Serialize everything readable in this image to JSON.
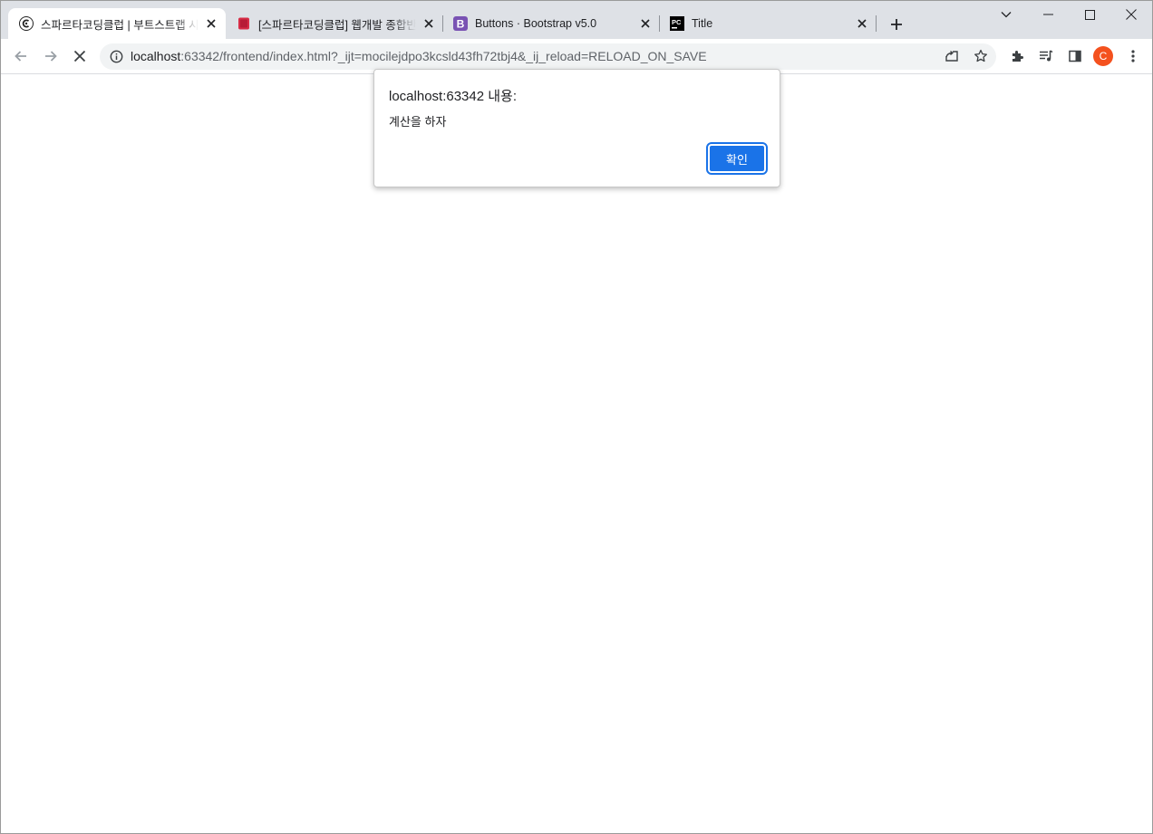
{
  "tabs": [
    {
      "title": "스파르타코딩클럽 | 부트스트랩 시작 템플릿",
      "favicon": "sparta-icon",
      "active": true
    },
    {
      "title": "[스파르타코딩클럽] 웹개발 종합반",
      "favicon": "book-icon",
      "active": false
    },
    {
      "title": "Buttons · Bootstrap v5.0",
      "favicon": "bootstrap-icon",
      "favicon_text": "B",
      "active": false
    },
    {
      "title": "Title",
      "favicon": "pycharm-icon",
      "favicon_text": "PC",
      "active": false
    }
  ],
  "address_bar": {
    "host": "localhost",
    "rest": ":63342/frontend/index.html?_ijt=mocilejdpo3kcsld43fh72tbj4&_ij_reload=RELOAD_ON_SAVE"
  },
  "profile": {
    "initial": "C"
  },
  "alert": {
    "title": "localhost:63342 내용:",
    "message": "계산을 하자",
    "ok_label": "확인"
  },
  "colors": {
    "accent": "#1a73e8",
    "avatar": "#f4511e",
    "tabstrip": "#dee1e6"
  }
}
